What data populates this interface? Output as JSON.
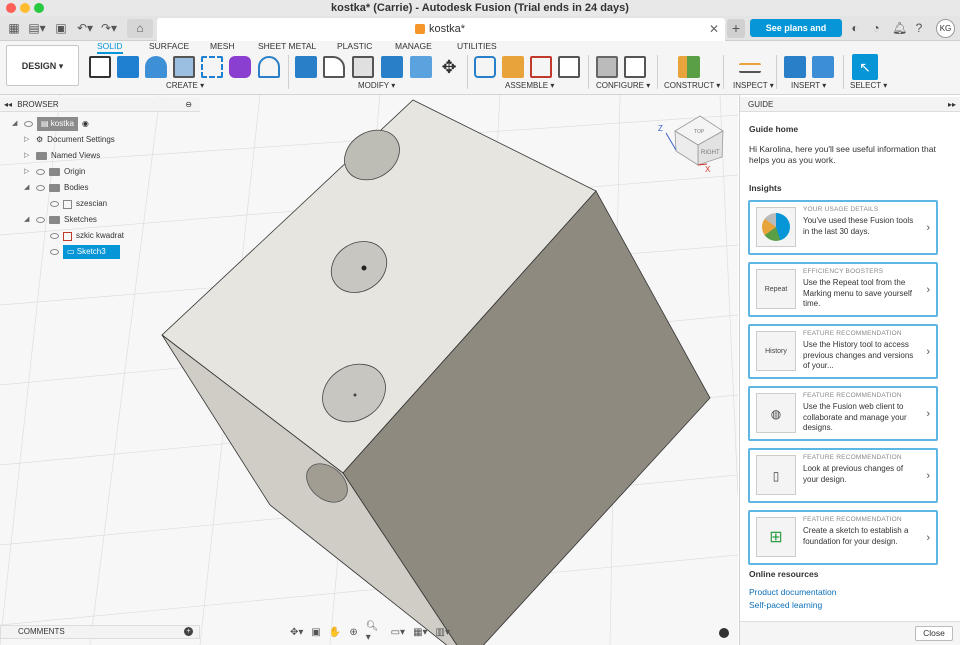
{
  "window": {
    "title": "kostka* (Carrie) - Autodesk Fusion (Trial ends in 24 days)"
  },
  "tabs": {
    "document_tab": "kostka*",
    "plans_button": "See plans and pricing",
    "avatar_initials": "KG"
  },
  "toolbar": {
    "design_button": "DESIGN",
    "workspace_tabs": [
      "SOLID",
      "SURFACE",
      "MESH",
      "SHEET METAL",
      "PLASTIC",
      "MANAGE",
      "UTILITIES"
    ],
    "groups": {
      "create": "CREATE",
      "modify": "MODIFY",
      "assemble": "ASSEMBLE",
      "configure": "CONFIGURE",
      "construct": "CONSTRUCT",
      "inspect": "INSPECT",
      "insert": "INSERT",
      "select": "SELECT"
    }
  },
  "browser": {
    "title": "BROWSER",
    "root": "kostka",
    "items": {
      "document_settings": "Document Settings",
      "named_views": "Named Views",
      "origin": "Origin",
      "bodies": "Bodies",
      "body_1": "szescian",
      "sketches": "Sketches",
      "sketch_1": "szkic kwadrat",
      "sketch_2": "Sketch3"
    }
  },
  "comments": {
    "label": "COMMENTS"
  },
  "viewcube": {
    "face_right": "RIGHT",
    "face_top": "TOP",
    "axis_z": "Z",
    "axis_x": "X"
  },
  "guide": {
    "panel_title": "GUIDE",
    "home_title": "Guide home",
    "intro": "Hi Karolina, here you'll see useful information that helps you as you work.",
    "insights_title": "Insights",
    "cards": [
      {
        "kicker": "YOUR USAGE DETAILS",
        "text": "You've used these Fusion tools in the last 30 days.",
        "thumb": ""
      },
      {
        "kicker": "EFFICIENCY BOOSTERS",
        "text": "Use the Repeat tool from the Marking menu to save yourself time.",
        "thumb": "Repeat"
      },
      {
        "kicker": "FEATURE RECOMMENDATION",
        "text": "Use the History tool to access previous changes and versions of your...",
        "thumb": "History"
      },
      {
        "kicker": "FEATURE RECOMMENDATION",
        "text": "Use the Fusion web client to collaborate and manage your designs.",
        "thumb": ""
      },
      {
        "kicker": "FEATURE RECOMMENDATION",
        "text": "Look at previous changes of your design.",
        "thumb": ""
      },
      {
        "kicker": "FEATURE RECOMMENDATION",
        "text": "Create a sketch to establish a foundation for your design.",
        "thumb": ""
      }
    ],
    "online_title": "Online resources",
    "links": [
      "Product documentation",
      "Self-paced learning"
    ],
    "close_button": "Close"
  },
  "colors": {
    "accent": "#0696d7",
    "cube_top": "#e6e5df",
    "cube_side": "#8f8a80",
    "cube_left": "#cfcdc5"
  }
}
